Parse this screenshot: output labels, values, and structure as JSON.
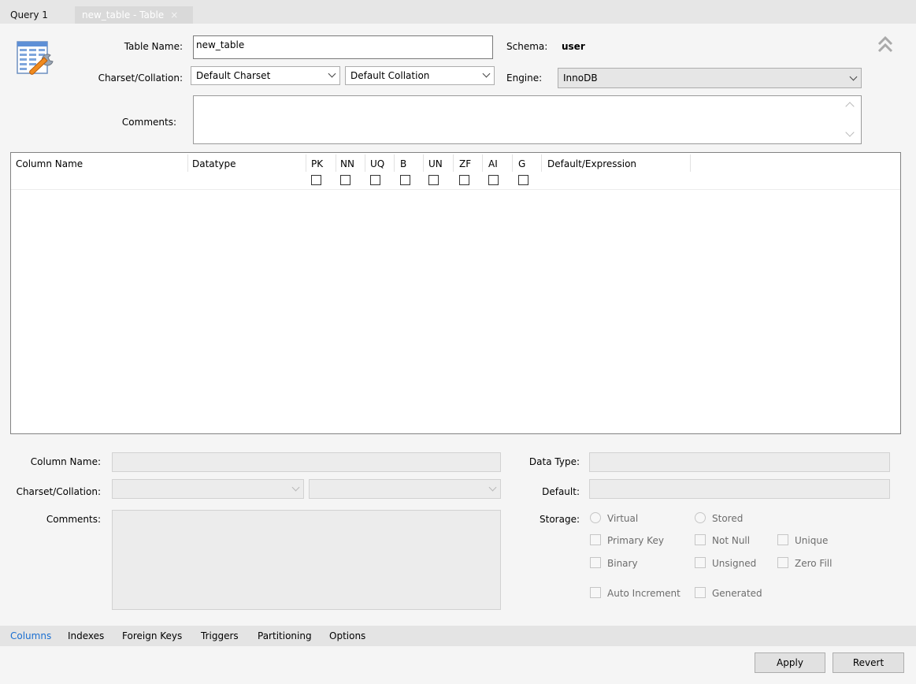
{
  "tabs": [
    {
      "label": "Query 1"
    },
    {
      "label": "new_table - Table",
      "close": "×"
    }
  ],
  "form": {
    "table_name_label": "Table Name:",
    "table_name_value": "new_table",
    "schema_label": "Schema:",
    "schema_value": "user",
    "charset_label": "Charset/Collation:",
    "charset_value": "Default Charset",
    "collation_value": "Default Collation",
    "engine_label": "Engine:",
    "engine_value": "InnoDB",
    "comments_label": "Comments:",
    "comments_value": ""
  },
  "grid": {
    "headers": [
      "Column Name",
      "Datatype",
      "PK",
      "NN",
      "UQ",
      "B",
      "UN",
      "ZF",
      "AI",
      "G",
      "Default/Expression"
    ],
    "rows": []
  },
  "details": {
    "column_name_label": "Column Name:",
    "charset_label": "Charset/Collation:",
    "comments_label": "Comments:",
    "data_type_label": "Data Type:",
    "default_label": "Default:",
    "storage_label": "Storage:",
    "virtual_label": "Virtual",
    "stored_label": "Stored",
    "primary_key_label": "Primary Key",
    "not_null_label": "Not Null",
    "unique_label": "Unique",
    "binary_label": "Binary",
    "unsigned_label": "Unsigned",
    "zero_fill_label": "Zero Fill",
    "auto_increment_label": "Auto Increment",
    "generated_label": "Generated"
  },
  "bottom_tabs": [
    "Columns",
    "Indexes",
    "Foreign Keys",
    "Triggers",
    "Partitioning",
    "Options"
  ],
  "active_bottom_tab": "Columns",
  "buttons": {
    "apply": "Apply",
    "revert": "Revert"
  },
  "colors": {
    "accent": "#1a6fd1",
    "background": "#f5f5f5"
  },
  "icons": {
    "table_editor": "table-wrench-icon",
    "collapse": "double-chevron-up-icon"
  }
}
